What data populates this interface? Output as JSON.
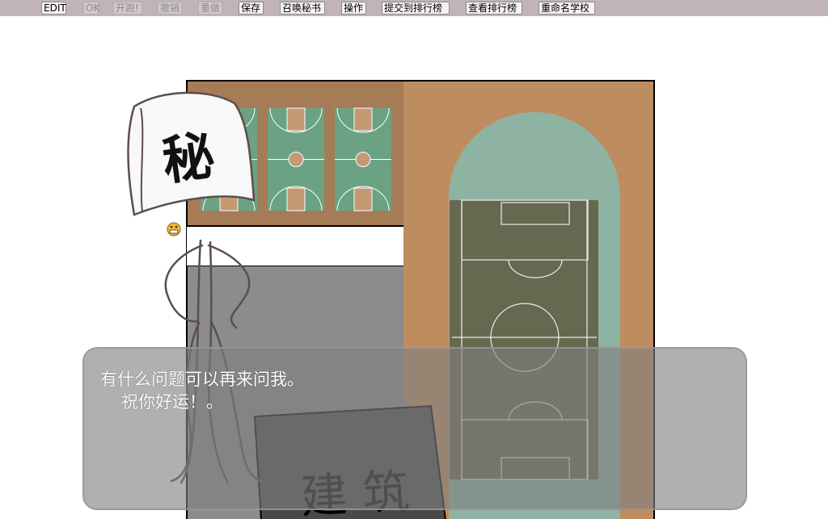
{
  "toolbar": {
    "buttons": [
      {
        "label": "EDIT",
        "enabled": true
      },
      {
        "label": "OK",
        "enabled": false
      },
      {
        "label": "开跑!",
        "enabled": false
      },
      {
        "label": "撤销",
        "enabled": false
      },
      {
        "label": "重做",
        "enabled": false
      },
      {
        "label": "保存",
        "enabled": true
      },
      {
        "label": "召唤秘书",
        "enabled": true
      },
      {
        "label": "操作",
        "enabled": true
      },
      {
        "label": "提交到排行榜",
        "enabled": true
      },
      {
        "label": "查看排行榜",
        "enabled": true
      },
      {
        "label": "重命名学校",
        "enabled": true
      }
    ]
  },
  "secretary": {
    "flag_text": "秘",
    "face_icon": "grinning-face-icon"
  },
  "map": {
    "building_label": "建 筑",
    "colors": {
      "ground": "#a57c55",
      "track": "#bd8c5f",
      "court_green": "#6aa283",
      "court_paint": "#c49a72",
      "field_green": "#66684f",
      "oval": "#8fb3a2",
      "building_gray": "#8c8c8c",
      "building_dark": "#4a4948"
    }
  },
  "dialog": {
    "line1": "有什么问题可以再来问我。",
    "line2": "祝你好运！。"
  }
}
